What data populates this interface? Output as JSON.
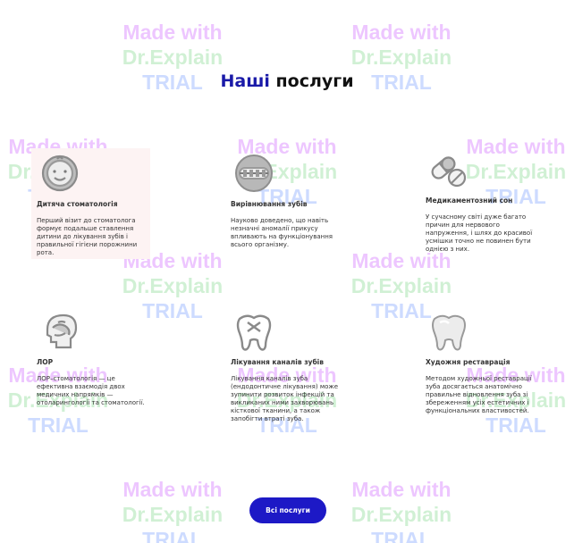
{
  "title": {
    "accent": "Наші",
    "rest": "послуги"
  },
  "watermark": {
    "line1": "Made with",
    "line2": "Dr.Explain",
    "line3": "TRIAL"
  },
  "services": [
    {
      "title": "Дитяча стоматологія",
      "text": "Перший візит до стоматолога формує подальше ставлення дитини до лікування зубів і правильної гігієни порожнини рота.",
      "icon": "child-face-icon"
    },
    {
      "title": "Вирівнювання зубів",
      "text": "Науково доведено, що навіть незначні аномалії прикусу впливають на функціонування всього організму.",
      "icon": "braces-icon"
    },
    {
      "title": "Медикаментозний сон",
      "text": "У сучасному світі дуже багато причин для нервового напруження, і шлях до красивої усмішки точно не повинен бути однією з них.",
      "icon": "pills-icon"
    },
    {
      "title": "ЛОР",
      "text": "ЛОР–стоматологія — це ефективна взаємодія двох медичних напрямків — отоларингології та стоматології.",
      "icon": "ent-head-icon"
    },
    {
      "title": "Лікування каналів зубів",
      "text": "Лікування каналів зуба (ендодонтичне лікування) може зупинити розвиток інфекцій та викликаних ними захворювань кісткової тканини, а також запобігти втраті зуба.",
      "icon": "tooth-canal-icon"
    },
    {
      "title": "Художня реставрація",
      "text": "Методом художньої реставрації зуба досягається анатомічно правильне відновлення зуба зі збереженням усіх естетичних і функціональних властивостей.",
      "icon": "tooth-icon"
    }
  ],
  "button": {
    "label": "Всі послуги"
  },
  "colors": {
    "accent": "#1a1aa8",
    "button": "#1d19c6"
  }
}
